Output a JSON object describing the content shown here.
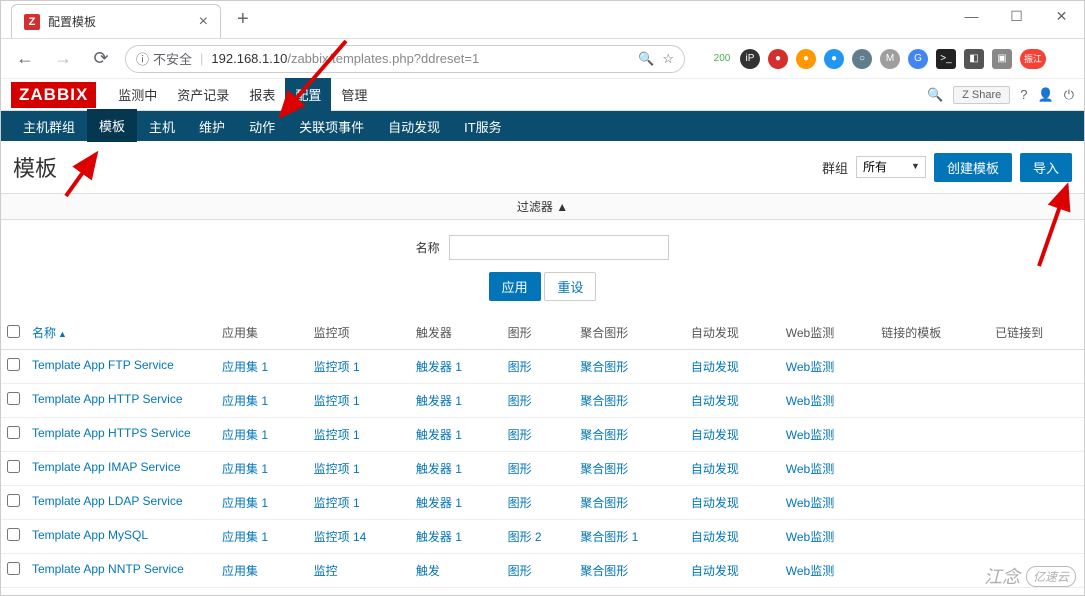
{
  "browser": {
    "tab_favicon": "Z",
    "tab_title": "配置模板",
    "insecure_label": "不安全",
    "url_host": "192.168.1.10",
    "url_path": "/zabbix/templates.php?ddreset=1",
    "ext_badge": "200"
  },
  "header": {
    "logo": "ZABBIX",
    "top_menu": [
      "监测中",
      "资产记录",
      "报表",
      "配置",
      "管理"
    ],
    "top_menu_active": 3,
    "share": "Share",
    "sub_menu": [
      "主机群组",
      "模板",
      "主机",
      "维护",
      "动作",
      "关联项事件",
      "自动发现",
      "IT服务"
    ],
    "sub_menu_active": 1
  },
  "page": {
    "title": "模板",
    "group_label": "群组",
    "group_value": "所有",
    "btn_create": "创建模板",
    "btn_import": "导入",
    "filter_label": "过滤器 ▲",
    "filter_name_label": "名称",
    "btn_apply": "应用",
    "btn_reset": "重设"
  },
  "table": {
    "columns": [
      "名称",
      "应用集",
      "监控项",
      "触发器",
      "图形",
      "聚合图形",
      "自动发现",
      "Web监测",
      "链接的模板",
      "已链接到"
    ],
    "sort_col": 0,
    "rows": [
      {
        "name": "Template App FTP Service",
        "app": "应用集 1",
        "items": "监控项 1",
        "trig": "触发器 1",
        "graph": "图形",
        "screen": "聚合图形",
        "disc": "自动发现",
        "web": "Web监测"
      },
      {
        "name": "Template App HTTP Service",
        "app": "应用集 1",
        "items": "监控项 1",
        "trig": "触发器 1",
        "graph": "图形",
        "screen": "聚合图形",
        "disc": "自动发现",
        "web": "Web监测"
      },
      {
        "name": "Template App HTTPS Service",
        "app": "应用集 1",
        "items": "监控项 1",
        "trig": "触发器 1",
        "graph": "图形",
        "screen": "聚合图形",
        "disc": "自动发现",
        "web": "Web监测"
      },
      {
        "name": "Template App IMAP Service",
        "app": "应用集 1",
        "items": "监控项 1",
        "trig": "触发器 1",
        "graph": "图形",
        "screen": "聚合图形",
        "disc": "自动发现",
        "web": "Web监测"
      },
      {
        "name": "Template App LDAP Service",
        "app": "应用集 1",
        "items": "监控项 1",
        "trig": "触发器 1",
        "graph": "图形",
        "screen": "聚合图形",
        "disc": "自动发现",
        "web": "Web监测"
      },
      {
        "name": "Template App MySQL",
        "app": "应用集 1",
        "items": "监控项 14",
        "trig": "触发器 1",
        "graph": "图形 2",
        "screen": "聚合图形 1",
        "disc": "自动发现",
        "web": "Web监测"
      },
      {
        "name": "Template App NNTP Service",
        "app": "应用集",
        "items": "监控",
        "trig": "触发",
        "graph": "图形",
        "screen": "聚合图形",
        "disc": "自动发现",
        "web": "Web监测"
      }
    ]
  },
  "watermark": {
    "text1": "江念",
    "text2": "亿速云"
  }
}
